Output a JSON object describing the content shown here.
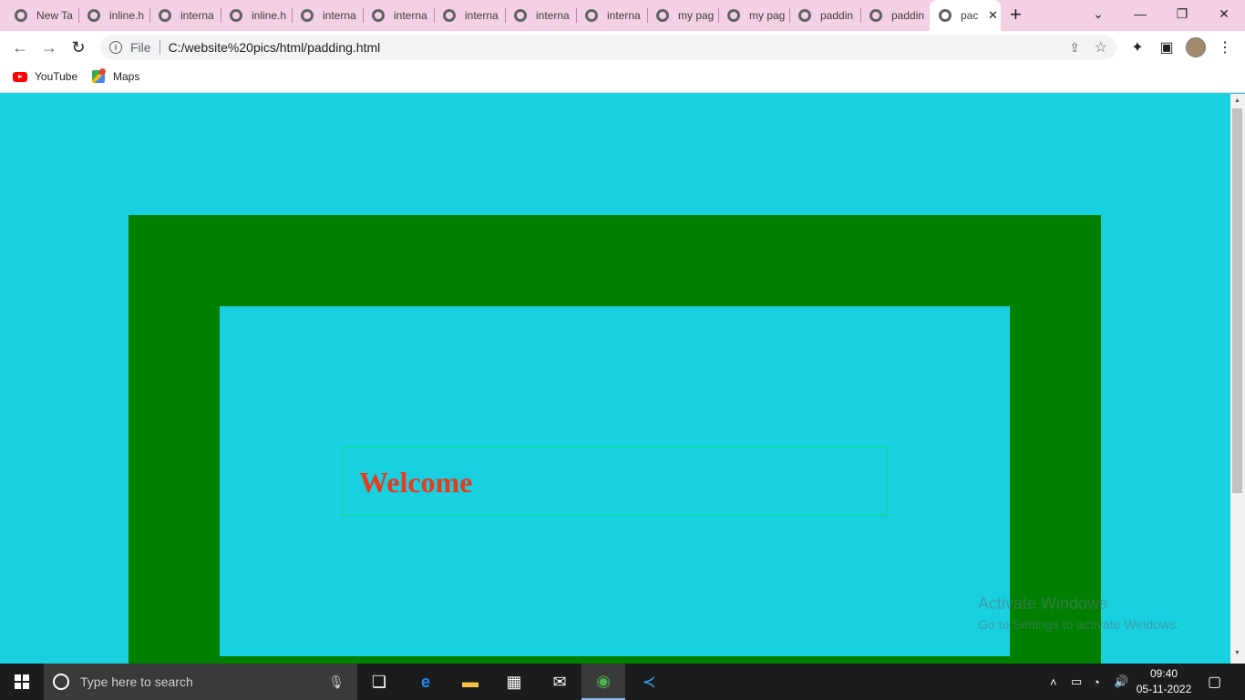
{
  "browser": {
    "tabs": [
      {
        "label": "New Ta",
        "active": false
      },
      {
        "label": "inline.h",
        "active": false
      },
      {
        "label": "interna",
        "active": false
      },
      {
        "label": "inline.h",
        "active": false
      },
      {
        "label": "interna",
        "active": false
      },
      {
        "label": "interna",
        "active": false
      },
      {
        "label": "interna",
        "active": false
      },
      {
        "label": "interna",
        "active": false
      },
      {
        "label": "interna",
        "active": false
      },
      {
        "label": "my pag",
        "active": false
      },
      {
        "label": "my pag",
        "active": false
      },
      {
        "label": "paddin",
        "active": false
      },
      {
        "label": "paddin",
        "active": false
      },
      {
        "label": "pac",
        "active": true
      }
    ],
    "address": {
      "scheme_label": "File",
      "url": "C:/website%20pics/html/padding.html"
    },
    "bookmarks": [
      {
        "label": "YouTube",
        "icon": "youtube-icon"
      },
      {
        "label": "Maps",
        "icon": "maps-icon"
      }
    ]
  },
  "page": {
    "heading": "Welcome",
    "colors": {
      "background": "#18d0df",
      "outer_box": "#008000",
      "inner_box": "#18d0df",
      "heading": "#e83a1c",
      "heading_border": "#00e27a"
    }
  },
  "watermark": {
    "line1": "Activate Windows",
    "line2": "Go to Settings to activate Windows."
  },
  "taskbar": {
    "search_placeholder": "Type here to search",
    "time": "09:40",
    "date": "05-11-2022"
  }
}
